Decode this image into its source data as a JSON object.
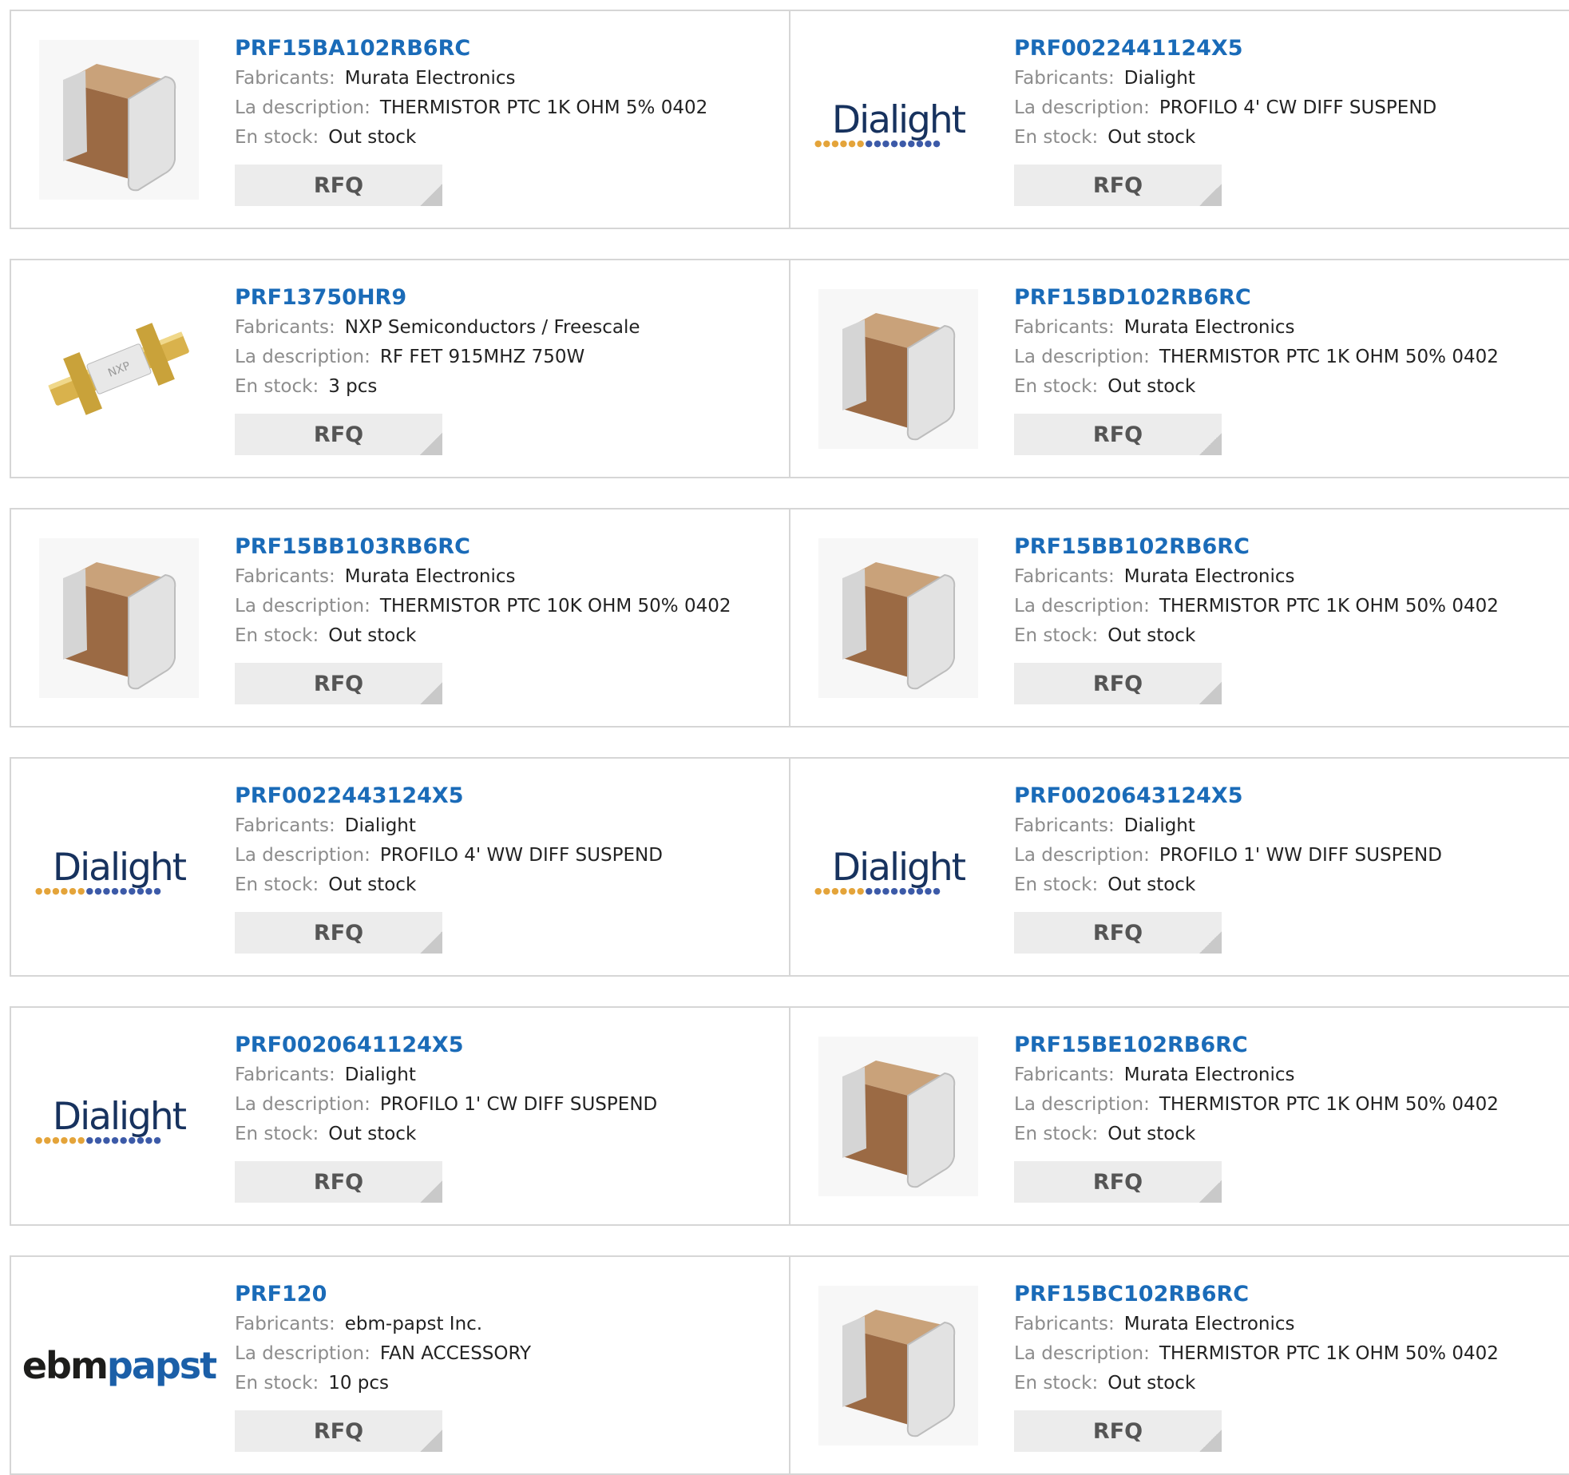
{
  "labels": {
    "manufacturer": "Fabricants:",
    "description": "La description:",
    "stock": "En stock:",
    "rfq": "RFQ"
  },
  "products": [
    {
      "part": "PRF15BA102RB6RC",
      "manufacturer": "Murata Electronics",
      "description": "THERMISTOR PTC 1K OHM 5% 0402",
      "stock": "Out stock",
      "image": "chip-component"
    },
    {
      "part": "PRF0022441124X5",
      "manufacturer": "Dialight",
      "description": "PROFILO 4' CW DIFF SUSPEND",
      "stock": "Out stock",
      "image": "dialight-logo",
      "logo_text": "Dialight"
    },
    {
      "part": "PRF13750HR9",
      "manufacturer": "NXP Semiconductors / Freescale",
      "description": "RF FET 915MHZ 750W",
      "stock": "3 pcs",
      "image": "rf-transistor",
      "logo_text": "NXP"
    },
    {
      "part": "PRF15BD102RB6RC",
      "manufacturer": "Murata Electronics",
      "description": "THERMISTOR PTC 1K OHM 50% 0402",
      "stock": "Out stock",
      "image": "chip-component"
    },
    {
      "part": "PRF15BB103RB6RC",
      "manufacturer": "Murata Electronics",
      "description": "THERMISTOR PTC 10K OHM 50% 0402",
      "stock": "Out stock",
      "image": "chip-component"
    },
    {
      "part": "PRF15BB102RB6RC",
      "manufacturer": "Murata Electronics",
      "description": "THERMISTOR PTC 1K OHM 50% 0402",
      "stock": "Out stock",
      "image": "chip-component"
    },
    {
      "part": "PRF0022443124X5",
      "manufacturer": "Dialight",
      "description": "PROFILO 4' WW DIFF SUSPEND",
      "stock": "Out stock",
      "image": "dialight-logo",
      "logo_text": "Dialight"
    },
    {
      "part": "PRF0020643124X5",
      "manufacturer": "Dialight",
      "description": "PROFILO 1' WW DIFF SUSPEND",
      "stock": "Out stock",
      "image": "dialight-logo",
      "logo_text": "Dialight"
    },
    {
      "part": "PRF0020641124X5",
      "manufacturer": "Dialight",
      "description": "PROFILO 1' CW DIFF SUSPEND",
      "stock": "Out stock",
      "image": "dialight-logo",
      "logo_text": "Dialight"
    },
    {
      "part": "PRF15BE102RB6RC",
      "manufacturer": "Murata Electronics",
      "description": "THERMISTOR PTC 1K OHM 50% 0402",
      "stock": "Out stock",
      "image": "chip-component"
    },
    {
      "part": "PRF120",
      "manufacturer": "ebm-papst Inc.",
      "description": "FAN ACCESSORY",
      "stock": "10 pcs",
      "image": "ebmpapst-logo",
      "logo_text": [
        "ebm",
        "papst"
      ]
    },
    {
      "part": "PRF15BC102RB6RC",
      "manufacturer": "Murata Electronics",
      "description": "THERMISTOR PTC 1K OHM 50% 0402",
      "stock": "Out stock",
      "image": "chip-component"
    }
  ],
  "colors": {
    "part_link": "#1a6bb8",
    "label": "#8c8c8c",
    "rfq_bg": "#ececec",
    "border": "#d6d6d6"
  }
}
